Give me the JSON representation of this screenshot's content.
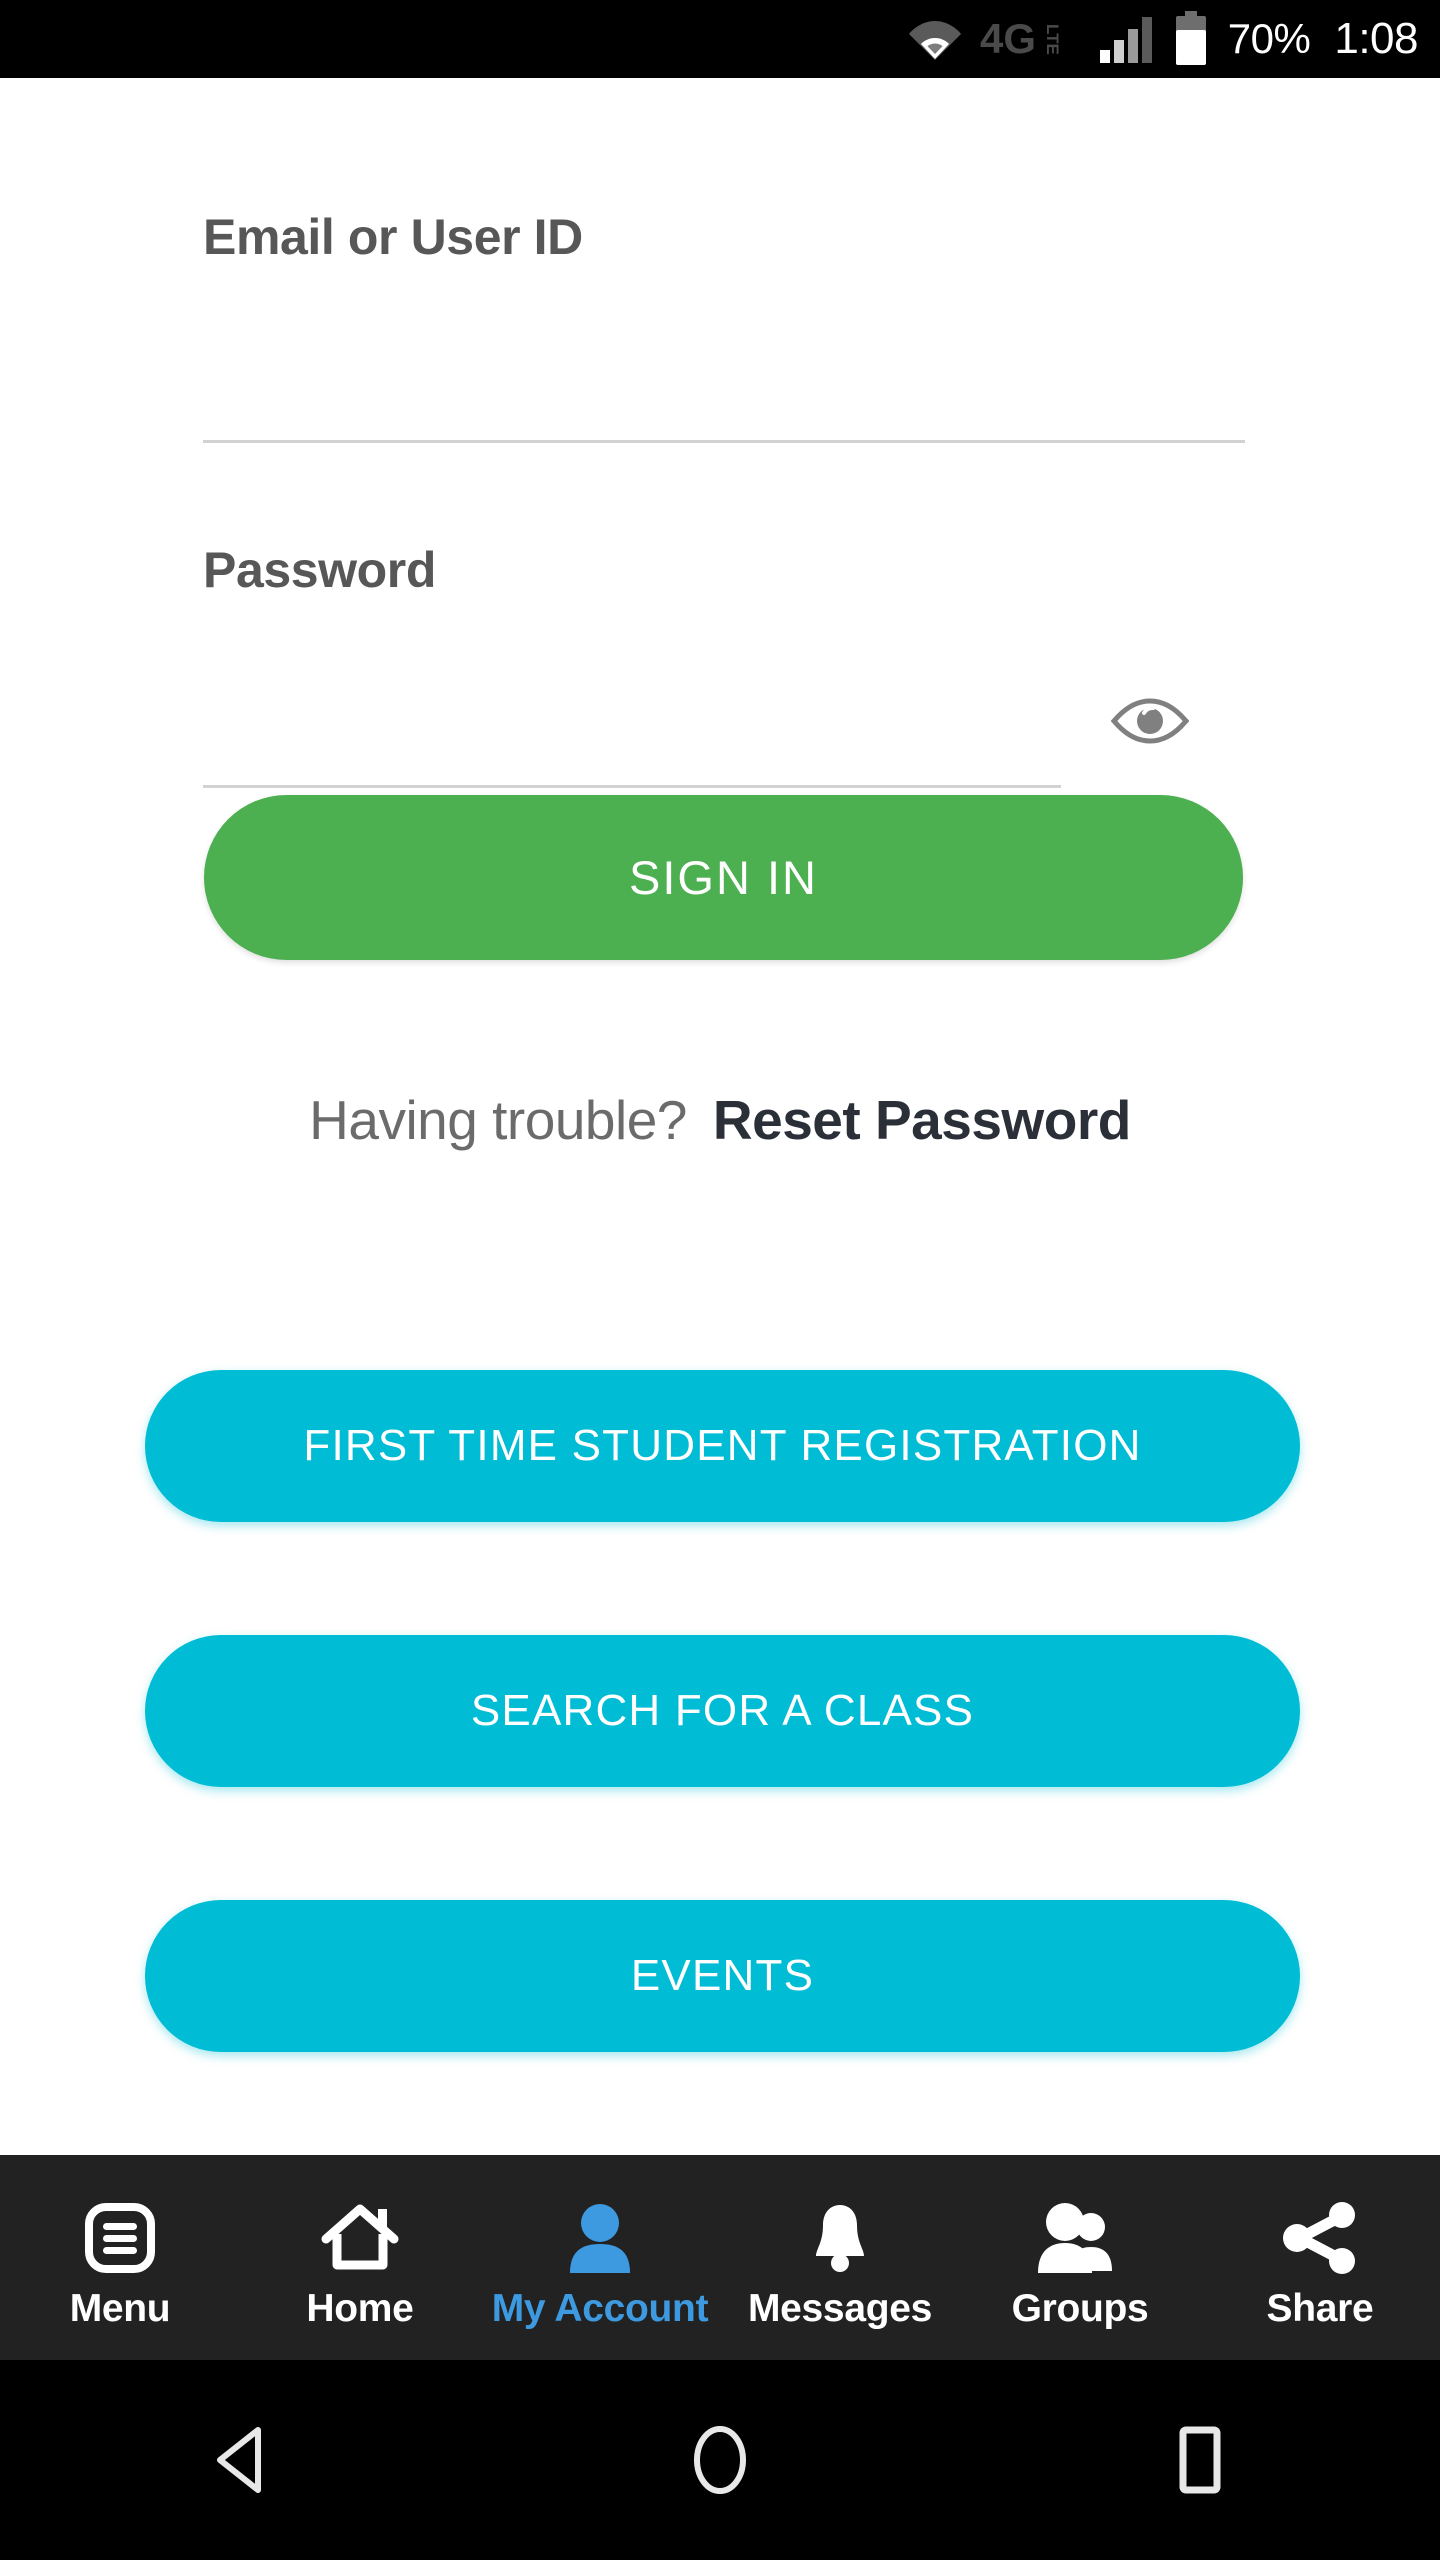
{
  "status_bar": {
    "network_label": "4G",
    "network_sub": "LTE",
    "battery_percent": "70%",
    "time": "1:08",
    "icons": {
      "wifi": "wifi-icon",
      "signal": "signal-bars-icon",
      "battery": "battery-icon"
    },
    "battery_level": 70,
    "background": "#000000"
  },
  "form": {
    "email": {
      "label": "Email or User ID",
      "value": "",
      "placeholder": ""
    },
    "password": {
      "label": "Password",
      "value": "",
      "placeholder": "",
      "toggle_icon": "eye-icon"
    }
  },
  "actions": {
    "sign_in": "SIGN IN",
    "sign_in_color": "#4caf50"
  },
  "help": {
    "question": "Having trouble?",
    "link": "Reset Password"
  },
  "quick_links": {
    "accent_color": "#00bcd4",
    "items": [
      {
        "label": "FIRST TIME STUDENT REGISTRATION"
      },
      {
        "label": "SEARCH FOR A CLASS"
      },
      {
        "label": "EVENTS"
      },
      {
        "label": ""
      }
    ]
  },
  "bottom_nav": {
    "active_color": "#3d9ae0",
    "background": "#222222",
    "items": [
      {
        "label": "Menu",
        "icon": "menu-list-icon",
        "active": false
      },
      {
        "label": "Home",
        "icon": "home-icon",
        "active": false
      },
      {
        "label": "My Account",
        "icon": "person-icon",
        "active": true
      },
      {
        "label": "Messages",
        "icon": "bell-icon",
        "active": false
      },
      {
        "label": "Groups",
        "icon": "people-group-icon",
        "active": false
      },
      {
        "label": "Share",
        "icon": "share-nodes-icon",
        "active": false
      }
    ]
  },
  "system_nav": {
    "back": "back-triangle-icon",
    "home": "home-circle-icon",
    "recents": "recents-square-icon"
  }
}
